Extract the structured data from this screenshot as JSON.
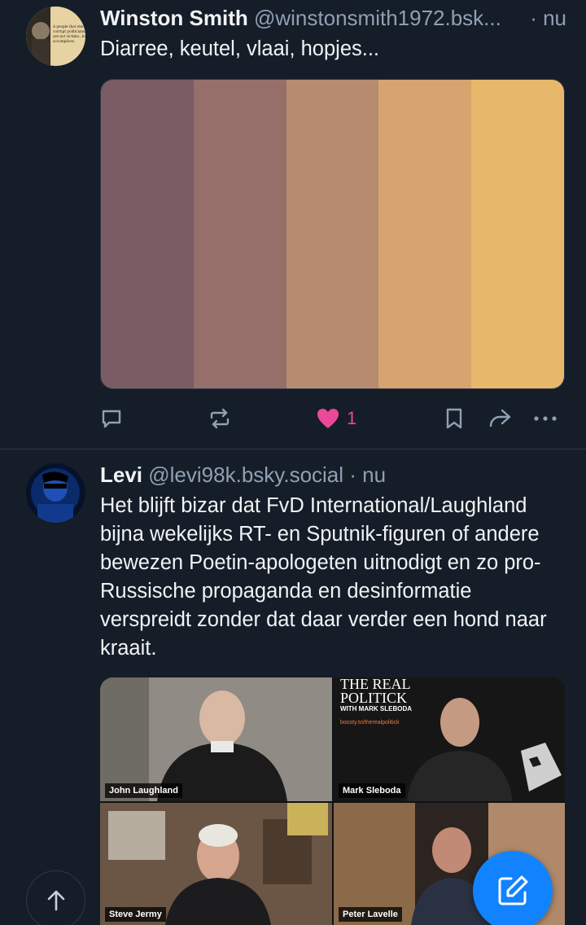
{
  "posts": [
    {
      "display_name": "Winston Smith",
      "handle": "@winstonsmith1972.bsk...",
      "time": "· nu",
      "text": "Diarree, keutel, vlaai, hopjes...",
      "avatar_text": "A people that elect corrupt politicians... are not victims... but accomplices.",
      "palette": [
        "#7b5c64",
        "#966f6b",
        "#b78b70",
        "#d7a46f",
        "#e8b86a"
      ],
      "actions": {
        "like_count": "1"
      }
    },
    {
      "display_name": "Levi",
      "handle": "@levi98k.bsky.social",
      "time": "· nu",
      "text": "Het blijft bizar dat FvD International/Laughland bijna wekelijks RT- en Sputnik-figuren of andere bewezen Poetin-apologeten uitnodigt en zo pro-Russische propaganda en desinformatie verspreidt zonder dat daar verder een hond naar kraait.",
      "video": {
        "participants": [
          "John Laughland",
          "Mark Sleboda",
          "Steve Jermy",
          "Peter Lavelle"
        ],
        "brand_title": "THE REAL POLITICK",
        "brand_sub": "WITH MARK SLEBODA",
        "brand_link": "boosty.to/therealpolitick"
      }
    }
  ],
  "colors": {
    "accent": "#1183fe",
    "like": "#ec4899",
    "background": "#151d28",
    "muted": "#8fa0b3"
  }
}
